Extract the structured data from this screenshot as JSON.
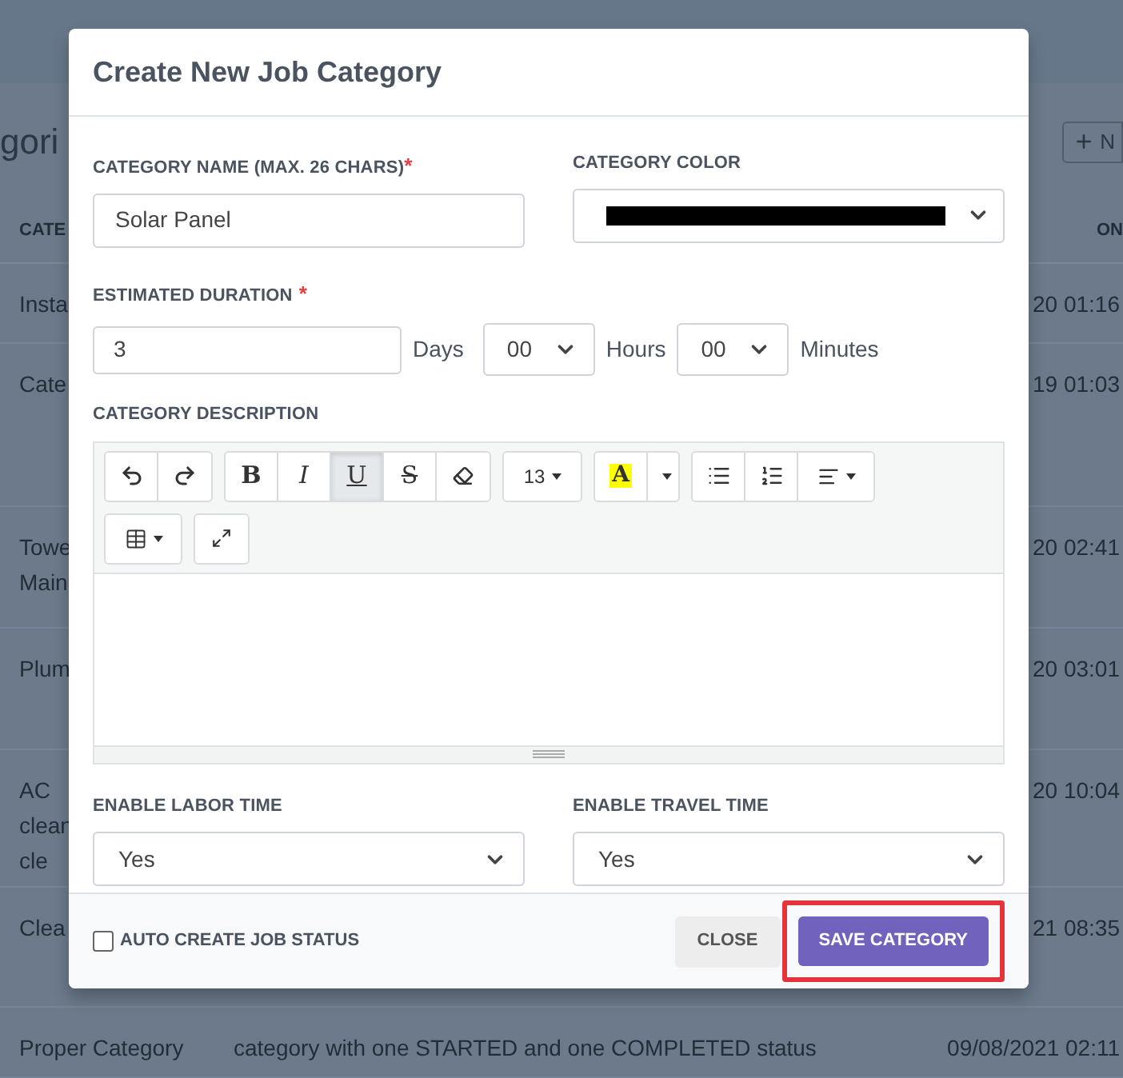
{
  "background": {
    "heading": "gori",
    "add_button": "N",
    "columns": [
      "CATE",
      "ON"
    ],
    "rows": [
      {
        "name": [
          "Insta"
        ],
        "date": "20 01:16"
      },
      {
        "name": [
          "Cate"
        ],
        "date": "19 01:03"
      },
      {
        "name": [
          "Towe",
          "Main"
        ],
        "date": "20 02:41"
      },
      {
        "name": [
          "Plum"
        ],
        "date": "20 03:01"
      },
      {
        "name": [
          "AC",
          "clean",
          "cle"
        ],
        "date": "20 10:04"
      },
      {
        "name": [
          "Clea"
        ],
        "date": "21 08:35"
      },
      {
        "name": [
          "Proper Category"
        ],
        "description": "category with one STARTED and one COMPLETED status",
        "date": "09/08/2021 02:11"
      }
    ]
  },
  "dialog": {
    "title": "Create New Job Category",
    "category_name": {
      "label": "CATEGORY NAME (MAX. 26 CHARS)",
      "required_mark": "*",
      "value": "Solar Panel"
    },
    "category_color": {
      "label": "CATEGORY COLOR",
      "color": "#000000"
    },
    "estimated_duration": {
      "label": "ESTIMATED DURATION",
      "required_mark": "*",
      "days": "3",
      "days_unit": "Days",
      "hours": "00",
      "hours_unit": "Hours",
      "minutes": "00",
      "minutes_unit": "Minutes"
    },
    "description": {
      "label": "CATEGORY DESCRIPTION",
      "toolbar": [
        [
          {
            "kind": "undo",
            "selected": false
          },
          {
            "kind": "redo",
            "selected": false
          }
        ],
        [
          {
            "kind": "bold",
            "text": "B",
            "selected": false
          },
          {
            "kind": "italic",
            "text": "I",
            "selected": false
          },
          {
            "kind": "underline",
            "text": "U",
            "selected": true
          },
          {
            "kind": "strike",
            "text": "S",
            "selected": false
          },
          {
            "kind": "eraser",
            "selected": false
          }
        ],
        [
          {
            "kind": "fontsize",
            "text": "13",
            "selected": false
          }
        ],
        [
          {
            "kind": "highlight",
            "text": "A",
            "selected": false
          },
          {
            "kind": "caret",
            "selected": false
          }
        ],
        [
          {
            "kind": "bullets",
            "selected": false
          },
          {
            "kind": "numbers",
            "selected": false
          },
          {
            "kind": "align",
            "selected": false
          }
        ],
        [
          {
            "kind": "table",
            "selected": false
          }
        ],
        [
          {
            "kind": "fullscreen",
            "selected": false
          }
        ]
      ]
    },
    "labor_time": {
      "label": "ENABLE LABOR TIME",
      "value": "Yes"
    },
    "travel_time": {
      "label": "ENABLE TRAVEL TIME",
      "value": "Yes"
    },
    "footer": {
      "auto_status": {
        "label": "AUTO CREATE JOB STATUS",
        "checked": false
      },
      "close": "CLOSE",
      "save": {
        "label": "SAVE CATEGORY",
        "highlighted": true
      }
    }
  }
}
